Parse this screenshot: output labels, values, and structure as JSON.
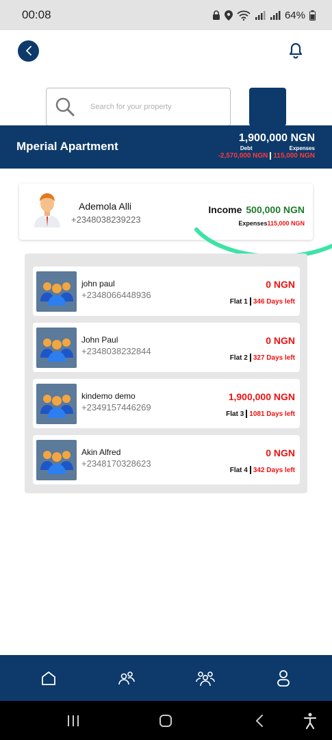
{
  "status_bar": {
    "time": "00:08",
    "battery": "64%"
  },
  "search": {
    "placeholder": "Search for your property"
  },
  "property": {
    "name": "Mperial Apartment",
    "balance": "1,900,000 NGN",
    "debt_label": "Debt",
    "expenses_label": "Expenses",
    "debt_value": "-2,570,000 NGN",
    "expenses_value": "115,000 NGN"
  },
  "owner": {
    "name": "Ademola Alli",
    "phone": "+2348038239223",
    "income_label": "Income",
    "income_value": "500,000 NGN",
    "expenses_label": "Expenses",
    "expenses_value": "115,000 NGN"
  },
  "tenants": [
    {
      "name": "john paul",
      "phone": "+2348066448936",
      "amount": "0 NGN",
      "flat": "Flat 1",
      "days": "346 Days left"
    },
    {
      "name": "John Paul",
      "phone": "+2348038232844",
      "amount": "0 NGN",
      "flat": "Flat 2",
      "days": "327 Days left"
    },
    {
      "name": "kindemo demo",
      "phone": "+2349157446269",
      "amount": "1,900,000 NGN",
      "flat": "Flat 3",
      "days": "1081 Days left"
    },
    {
      "name": "Akin Alfred",
      "phone": "+2348170328623",
      "amount": "0 NGN",
      "flat": "Flat 4",
      "days": "342 Days left"
    }
  ],
  "icons": {
    "back": "chevron-left-icon",
    "bell": "bell-icon",
    "search": "search-icon",
    "nav": [
      "home-icon",
      "users-icon",
      "group-icon",
      "profile-icon"
    ]
  },
  "colors": {
    "primary": "#0d3a6b",
    "income_green": "#1f7a2c",
    "alert_red": "#ee1111",
    "swoosh": "#3de3a6"
  }
}
